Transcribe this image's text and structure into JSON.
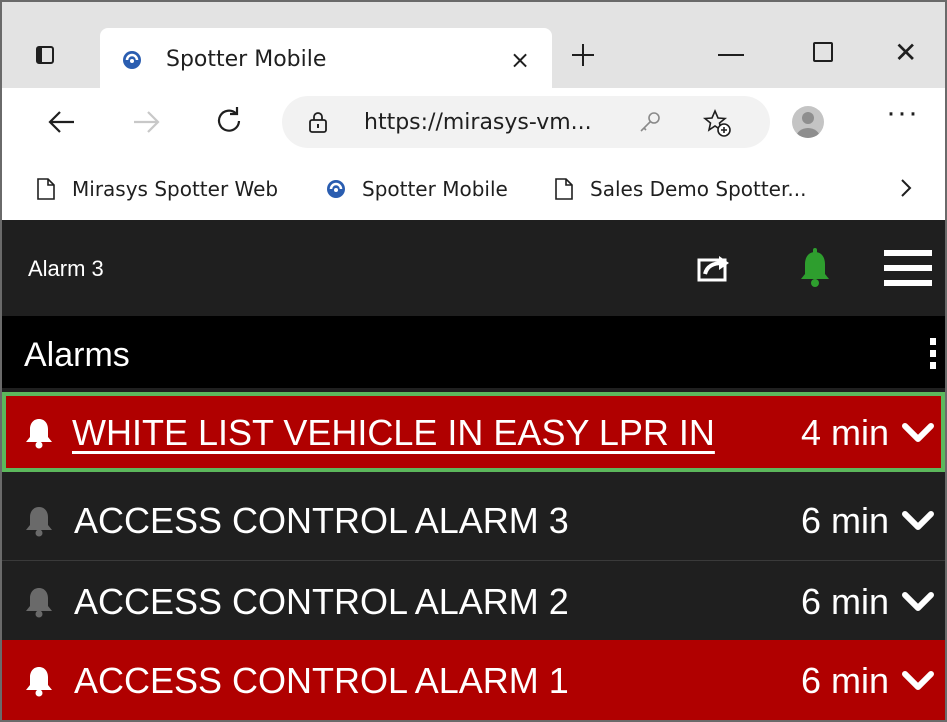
{
  "browser": {
    "tab_title": "Spotter Mobile",
    "tab_close": "×",
    "address_url": "https://mirasys-vm...",
    "window_close": "✕",
    "more": "···",
    "bookmarks": [
      {
        "label": "Mirasys Spotter Web",
        "icon": "page-icon"
      },
      {
        "label": "Spotter Mobile",
        "icon": "spotter-logo-icon"
      },
      {
        "label": "Sales Demo Spotter...",
        "icon": "page-icon"
      }
    ]
  },
  "app": {
    "title": "Alarm 3",
    "alarms_heading": "Alarms",
    "colors": {
      "alarm_active": "#b00000",
      "alarm_inactive": "#1f1f1f",
      "selected_border": "#5cb85c",
      "bell_active_header": "#2e9e2e"
    },
    "alarms": [
      {
        "label": "WHITE LIST VEHICLE IN EASY LPR IN",
        "time": "4 min",
        "active": true,
        "selected": true
      },
      {
        "label": "ACCESS CONTROL ALARM 3",
        "time": "6 min",
        "active": false,
        "selected": false
      },
      {
        "label": "ACCESS CONTROL ALARM 2",
        "time": "6 min",
        "active": false,
        "selected": false
      },
      {
        "label": "ACCESS CONTROL ALARM 1",
        "time": "6 min",
        "active": true,
        "selected": false
      }
    ]
  }
}
